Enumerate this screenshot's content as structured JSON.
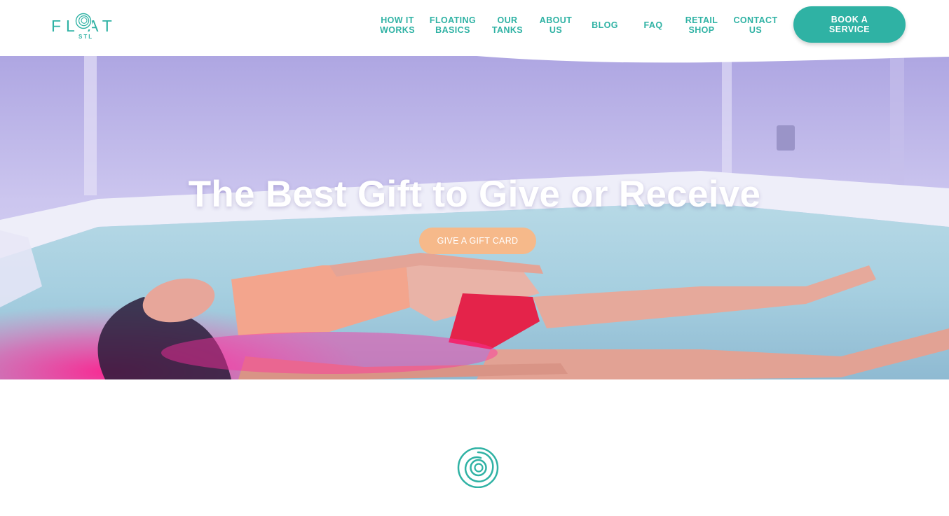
{
  "brand": {
    "logo_word": "FL AT",
    "logo_sub": "STL",
    "accent_color": "#2fb2a4"
  },
  "nav": {
    "items": [
      {
        "label": "HOW IT\nWORKS"
      },
      {
        "label": "FLOATING\nBASICS"
      },
      {
        "label": "OUR\nTANKS"
      },
      {
        "label": "ABOUT\nUS"
      },
      {
        "label": "BLOG"
      },
      {
        "label": "FAQ"
      },
      {
        "label": "RETAIL\nSHOP"
      },
      {
        "label": "CONTACT\nUS"
      }
    ],
    "cta_label": "BOOK A\nSERVICE"
  },
  "hero": {
    "title": "The Best Gift to Give or Receive",
    "button_label": "GIVE A GIFT CARD",
    "button_color": "#f6b98a",
    "image": "woman-floating-in-tank-photo"
  },
  "section": {
    "icon": "swirl-logo-icon"
  }
}
